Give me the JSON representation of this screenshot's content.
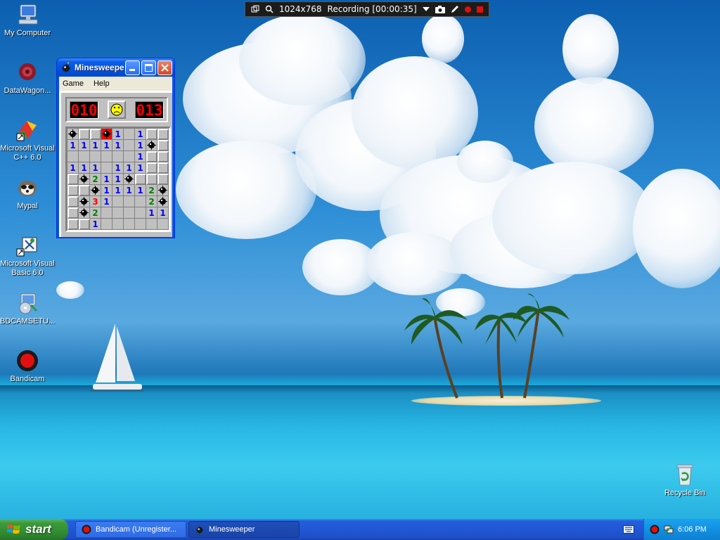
{
  "recorder": {
    "resolution": "1024x768",
    "status": "Recording [00:00:35]"
  },
  "desktop_icons": [
    {
      "label": "My Computer",
      "icon": "computer-icon"
    },
    {
      "label": "DataWagon...",
      "icon": "datawagon-icon"
    },
    {
      "label": "Microsoft Visual C++ 6.0",
      "icon": "visual-cpp-icon"
    },
    {
      "label": "Mypal",
      "icon": "mypal-icon"
    },
    {
      "label": "Microsoft Visual Basic 6.0",
      "icon": "visual-basic-icon"
    },
    {
      "label": "BDCAMSETU...",
      "icon": "installer-icon"
    },
    {
      "label": "Bandicam",
      "icon": "bandicam-icon"
    },
    {
      "label": "Recycle Bin",
      "icon": "recycle-bin-icon"
    }
  ],
  "minesweeper": {
    "title": "Minesweeper",
    "menu": [
      "Game",
      "Help"
    ],
    "mine_counter": "010",
    "timer": "013",
    "face": "dead",
    "grid": [
      [
        "M",
        "H",
        "H",
        "X",
        "1",
        "",
        "1",
        "H",
        "H"
      ],
      [
        "1",
        "1",
        "1",
        "1",
        "1",
        "",
        "1",
        "M",
        "H"
      ],
      [
        "",
        "",
        "",
        "",
        "",
        "",
        "1",
        "H",
        "H"
      ],
      [
        "1",
        "1",
        "1",
        "",
        "1",
        "1",
        "1",
        "H",
        "H"
      ],
      [
        "H",
        "M",
        "2",
        "1",
        "1",
        "M",
        "H",
        "H",
        "H"
      ],
      [
        "H",
        "H",
        "M",
        "1",
        "1",
        "1",
        "1",
        "2",
        "M"
      ],
      [
        "H",
        "M",
        "3",
        "1",
        "",
        "",
        "",
        "2",
        "M"
      ],
      [
        "H",
        "M",
        "2",
        "",
        "",
        "",
        "",
        "1",
        "1"
      ],
      [
        "H",
        "H",
        "1",
        "",
        "",
        "",
        "",
        "",
        ""
      ]
    ]
  },
  "taskbar": {
    "start_label": "start",
    "tasks": [
      {
        "label": "Bandicam (Unregister...",
        "icon": "bandicam-icon"
      },
      {
        "label": "Minesweeper",
        "icon": "minesweeper-icon"
      }
    ],
    "clock": "6:06 PM"
  },
  "colors": {
    "num1": "#0000ff",
    "num2": "#008000",
    "num3": "#ff0000",
    "xp_blue": "#245edb",
    "start_green": "#3c9a3c"
  }
}
